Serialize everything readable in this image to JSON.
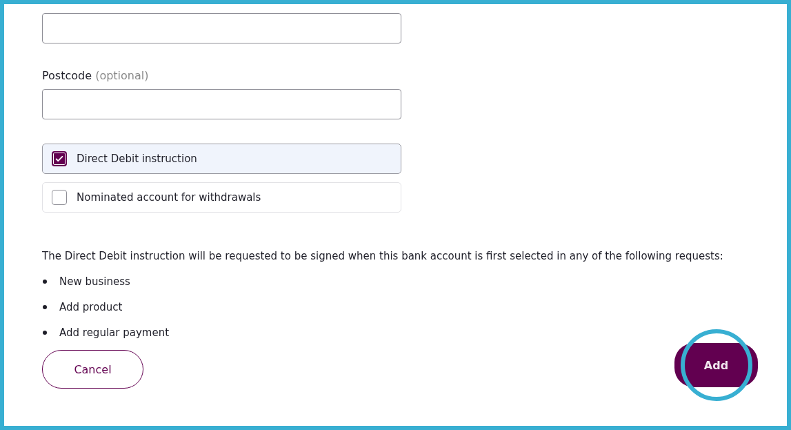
{
  "fields": [
    {
      "kind": "text"
    },
    {
      "kind": "text",
      "label": "Postcode",
      "hint": "(optional)"
    }
  ],
  "options": [
    {
      "label": "Direct Debit instruction",
      "checked": true
    },
    {
      "label": "Nominated account for withdrawals",
      "checked": false
    }
  ],
  "notice": "The Direct Debit instruction will be requested to be signed when this bank account is first selected in any of the following requests:",
  "requests": [
    "New business",
    "Add product",
    "Add regular payment"
  ],
  "buttons": [
    {
      "label": "Cancel",
      "kind": "secondary",
      "highlighted": false
    },
    {
      "label": "Add",
      "kind": "primary",
      "highlighted": true
    }
  ]
}
